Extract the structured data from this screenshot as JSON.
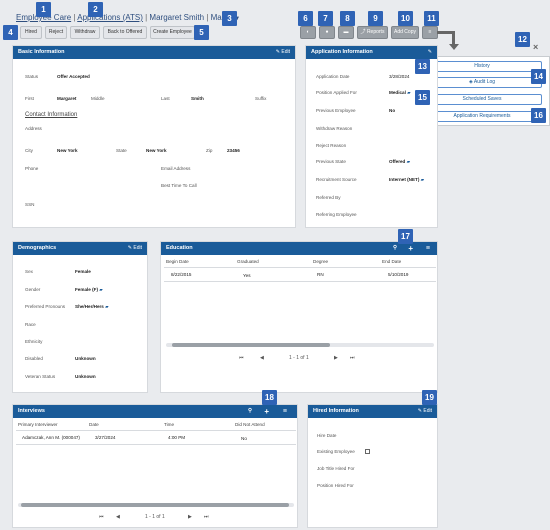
{
  "breadcrumb": {
    "part1": "Employee Care",
    "sep": " | ",
    "part2": "Applications (ATS)",
    "part3": "Margaret Smith",
    "part4": "Main"
  },
  "toolbar": {
    "hired": "Hired",
    "reject": "Reject",
    "withdraw": "Withdraw",
    "back_to_offered": "Back to Offered",
    "create_employee": "Create Employee",
    "views": "",
    "notes": "",
    "reports": "Reports",
    "add_copy": "Add Copy",
    "menu": "≡"
  },
  "callouts": [
    "1",
    "2",
    "3",
    "4",
    "5",
    "6",
    "7",
    "8",
    "9",
    "10",
    "11",
    "12",
    "13",
    "14",
    "15",
    "16",
    "17",
    "18",
    "19"
  ],
  "basic": {
    "title": "Basic Information",
    "edit": "✎ Edit",
    "status_label": "Status",
    "status": "Offer Accepted",
    "first_label": "First",
    "first": "Margaret",
    "middle_label": "Middle",
    "last_label": "Last",
    "last": "Smith",
    "suffix_label": "Suffix",
    "contact_title": "Contact Information",
    "address_label": "Address",
    "city_label": "City",
    "city": "New York",
    "state_label": "State",
    "state": "New York",
    "zip_label": "Zip",
    "zip": "23456",
    "phone_label": "Phone",
    "email_label": "Email Address",
    "best_time_label": "Best Time To Call",
    "ssn_label": "SSN"
  },
  "application": {
    "title": "Application Information",
    "edit": "✎",
    "date_label": "Application Date",
    "date": "3/28/2024",
    "position_label": "Position Applied For",
    "position": "Medical",
    "prev_emp_label": "Previous Employee",
    "prev_emp": "No",
    "withdraw_label": "Withdraw Reason",
    "reject_label": "Reject Reason",
    "prev_state_label": "Previous State",
    "prev_state": "Offered",
    "source_label": "Recruitment Source",
    "source": "Internet (NET)",
    "referred_label": "Referred By",
    "referring_label": "Referring Employee"
  },
  "menu": {
    "close": "×",
    "history": "History",
    "audit": "Audit Log",
    "saves": "Scheduled Saves",
    "requirements": "Application Requirements"
  },
  "demographics": {
    "title": "Demographics",
    "edit": "✎ Edit",
    "sex_label": "Sex",
    "sex": "Female",
    "gender_label": "Gender",
    "gender": "Female (F)",
    "pronouns_label": "Preferred Pronouns",
    "pronouns": "She/Her/Hers",
    "race_label": "Race",
    "ethnicity_label": "Ethnicity",
    "disabled_label": "Disabled",
    "disabled": "Unknown",
    "veteran_label": "Veteran Status",
    "veteran": "Unknown"
  },
  "education": {
    "title": "Education",
    "headers": [
      "Begin Date",
      "Graduated",
      "Degree",
      "End Date"
    ],
    "rows": [
      [
        "8/22/2015",
        "Yes",
        "RN",
        "5/10/2019"
      ]
    ],
    "pager": "1 - 1 of 1"
  },
  "interviews": {
    "title": "Interviews",
    "headers": [
      "Primary Interviewer",
      "Date",
      "Time",
      "Did Not Attend"
    ],
    "rows": [
      [
        "Adamczak, Ann M. (000047)",
        "3/27/2024",
        "4:00 PM",
        "No"
      ]
    ],
    "pager": "1 - 1 of 1"
  },
  "hired": {
    "title": "Hired Information",
    "edit": "✎ Edit",
    "hire_date_label": "Hire Date",
    "existing_label": "Existing Employee",
    "job_title_label": "Job Title Hired For",
    "position_label": "Position Hired For"
  }
}
